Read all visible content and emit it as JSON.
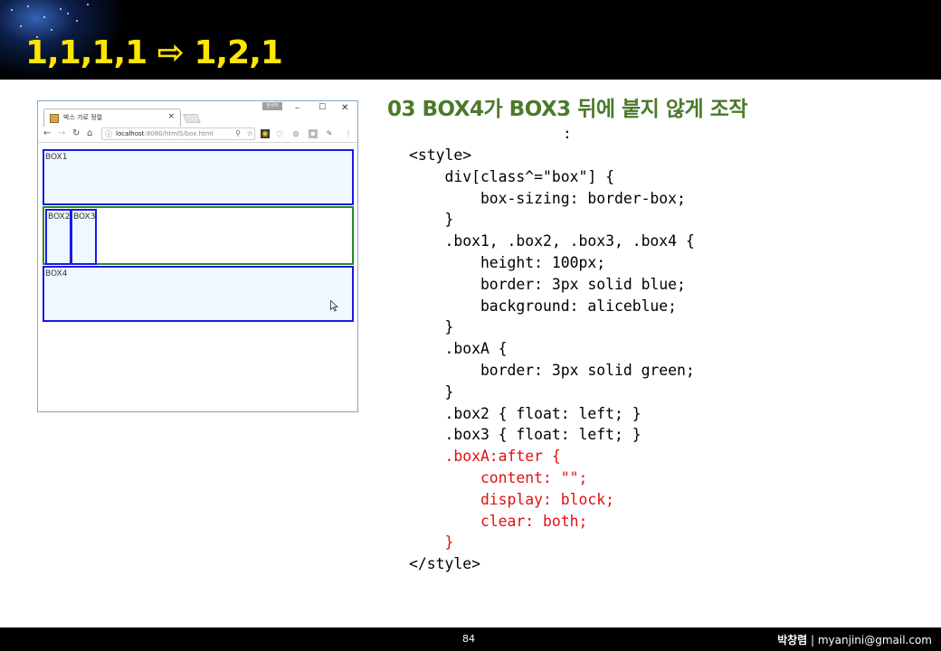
{
  "header": {
    "title": "1,1,1,1 ⇨ 1,2,1"
  },
  "browser": {
    "tab_title": "박스 가로 정렬",
    "tab_close": "×",
    "win_badge": "한국어",
    "win_min": "–",
    "win_max": "☐",
    "win_close": "✕",
    "url_host": "localhost",
    "url_path": ":8080/html5/box.html",
    "boxes": {
      "box1": "BOX1",
      "box2": "BOX2",
      "box3": "BOX3",
      "box4": "BOX4"
    }
  },
  "section_title": "03 BOX4가 BOX3 뒤에 붙지 않게 조작",
  "colon": ":",
  "code_lines": [
    {
      "text": "<style>",
      "color": "black"
    },
    {
      "text": "    div[class^=\"box\"] {",
      "color": "black"
    },
    {
      "text": "        box-sizing: border-box;",
      "color": "black"
    },
    {
      "text": "    }",
      "color": "black"
    },
    {
      "text": "    .box1, .box2, .box3, .box4 {",
      "color": "black"
    },
    {
      "text": "        height: 100px;",
      "color": "black"
    },
    {
      "text": "        border: 3px solid blue;",
      "color": "black"
    },
    {
      "text": "        background: aliceblue;",
      "color": "black"
    },
    {
      "text": "    }",
      "color": "black"
    },
    {
      "text": "    .boxA {",
      "color": "black"
    },
    {
      "text": "        border: 3px solid green;",
      "color": "black"
    },
    {
      "text": "    }",
      "color": "black"
    },
    {
      "text": "    .box2 { float: left; }",
      "color": "black"
    },
    {
      "text": "    .box3 { float: left; }",
      "color": "black"
    },
    {
      "text": "    .boxA:after {",
      "color": "red"
    },
    {
      "text": "        content: \"\";",
      "color": "red"
    },
    {
      "text": "        display: block;",
      "color": "red"
    },
    {
      "text": "        clear: both;",
      "color": "red"
    },
    {
      "text": "    }",
      "color": "red"
    },
    {
      "text": "</style>",
      "color": "black"
    }
  ],
  "footer": {
    "page_number": "84",
    "author_name": "박창렴",
    "author_sep": " | ",
    "author_email": "myanjini@gmail.com"
  },
  "colors": {
    "header_bg": "#000000",
    "title_yellow": "#ffe600",
    "section_green": "#4a7a2a",
    "code_red": "#e01010",
    "box_blue": "#1a1ae0",
    "box_bg": "#f0f8ff",
    "boxA_green": "#2a8a2a"
  }
}
